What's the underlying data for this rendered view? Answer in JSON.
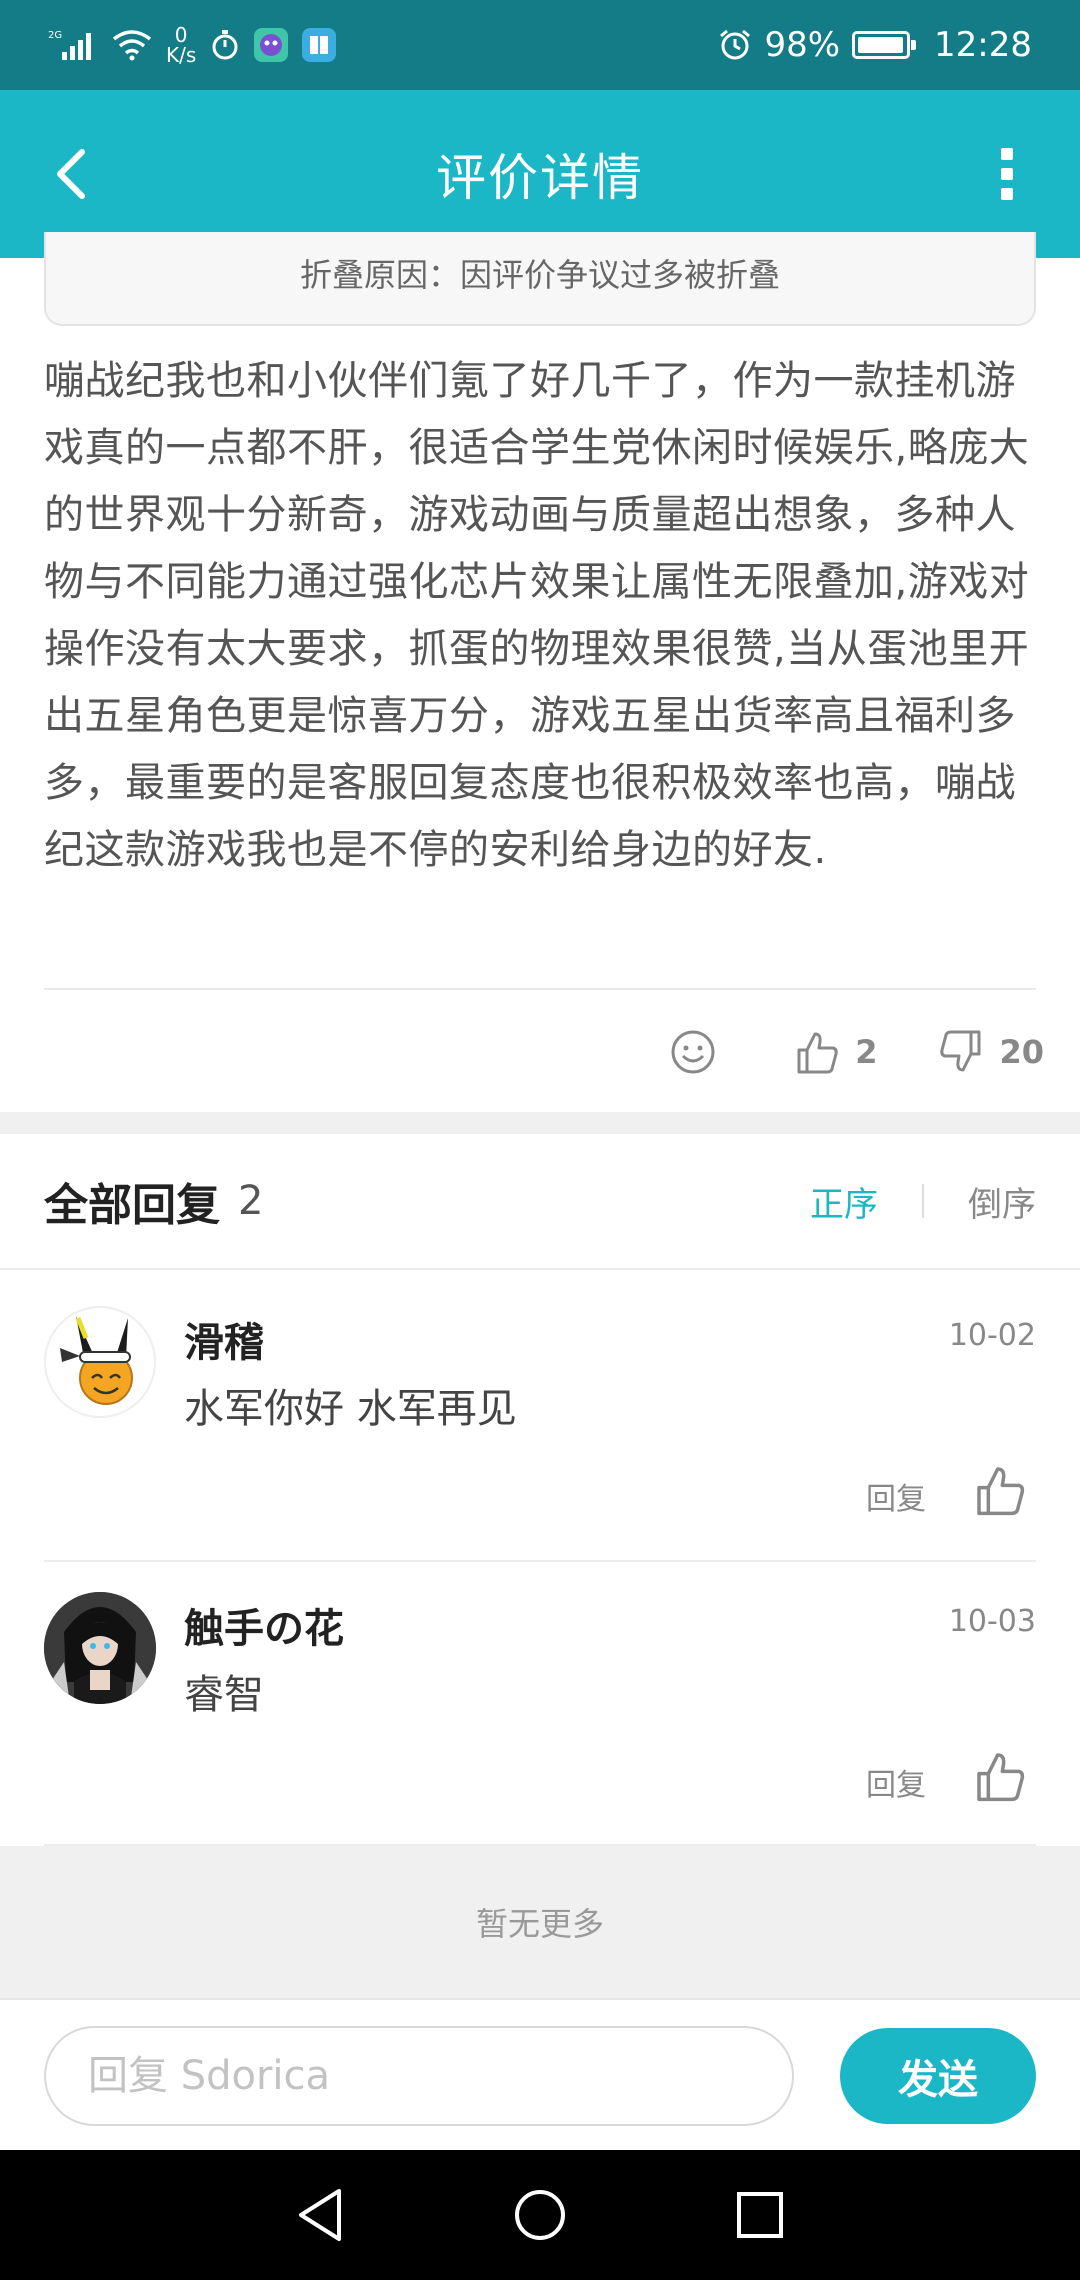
{
  "status_bar": {
    "network": "2G",
    "net_speed_value": "0",
    "net_speed_unit": "K/s",
    "battery_percent": "98%",
    "battery_level": 0.98,
    "time": "12:28"
  },
  "header": {
    "title": "评价详情"
  },
  "fold_notice": "折叠原因：因评价争议过多被折叠",
  "review": {
    "text": "嘣战纪我也和小伙伴们氪了好几千了，作为一款挂机游戏真的一点都不肝，很适合学生党休闲时候娱乐,略庞大的世界观十分新奇，游戏动画与质量超出想象，多种人物与不同能力通过强化芯片效果让属性无限叠加,游戏对操作没有太大要求，抓蛋的物理效果很赞,当从蛋池里开出五星角色更是惊喜万分，游戏五星出货率高且福利多多，最重要的是客服回复态度也很积极效率也高，嘣战纪这款游戏我也是不停的安利给身边的好友.",
    "likes": "2",
    "dislikes": "20"
  },
  "replies_section": {
    "title": "全部回复",
    "count": "2",
    "sort_asc": "正序",
    "sort_desc": "倒序",
    "items": [
      {
        "name": "滑稽",
        "date": "10-02",
        "content": "水军你好 水军再见",
        "reply_label": "回复"
      },
      {
        "name": "触手の花",
        "date": "10-03",
        "content": "睿智",
        "reply_label": "回复"
      }
    ],
    "no_more": "暂无更多"
  },
  "input_bar": {
    "placeholder": "回复 Sdorica",
    "send_label": "发送"
  },
  "colors": {
    "accent": "#1bb7c6",
    "status_bar": "#137c87"
  }
}
